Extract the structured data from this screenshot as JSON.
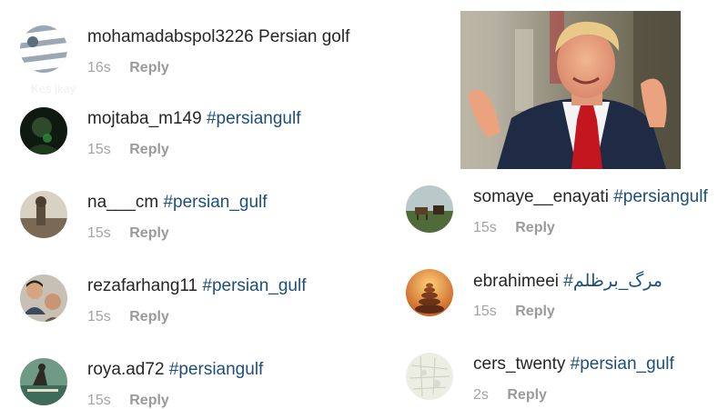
{
  "left_comments": [
    {
      "username": "mohamadabspol3226",
      "text": "Persian golf",
      "time": "16s",
      "reply": "Reply",
      "avatar": "striped-avatar-icon"
    },
    {
      "username": "mojtaba_m149",
      "text": "#persiangulf",
      "time": "15s",
      "reply": "Reply",
      "avatar": "dark-portrait-avatar"
    },
    {
      "username": "na___cm",
      "text": "#persian_gulf",
      "time": "15s",
      "reply": "Reply",
      "avatar": "landscape-avatar"
    },
    {
      "username": "rezafarhang11",
      "text": "#persian_gulf",
      "time": "15s",
      "reply": "Reply",
      "avatar": "couple-avatar"
    },
    {
      "username": "roya.ad72",
      "text": "#persiangulf",
      "time": "15s",
      "reply": "Reply",
      "avatar": "surfer-avatar"
    }
  ],
  "right_comments": [
    {
      "username": "somaye__enayati",
      "text": "#persiangulf",
      "time": "15s",
      "reply": "Reply",
      "avatar": "horses-avatar"
    },
    {
      "username": "ebrahimeei",
      "text": "#مرگ_برظلم",
      "time": "15s",
      "reply": "Reply",
      "avatar": "stones-sunset-avatar"
    },
    {
      "username": "cers_twenty",
      "text": "#persian_gulf",
      "time": "2s",
      "reply": "Reply",
      "avatar": "map-avatar"
    }
  ],
  "ghost_text": "Kes lkay",
  "colors": {
    "hashtag": "#1d4f7a",
    "username": "#262626",
    "meta": "#a3a3a3",
    "background": "#ffffff"
  },
  "photo": "man-in-suit-photo"
}
